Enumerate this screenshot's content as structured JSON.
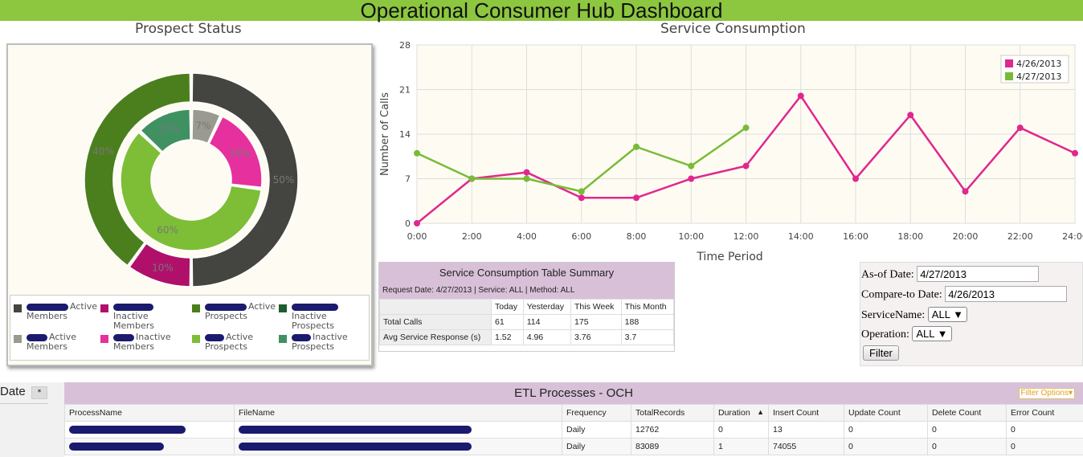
{
  "page_title": "Operational Consumer Hub Dashboard",
  "prospect_status": {
    "title": "Prospect Status",
    "outer_ring": [
      {
        "label": "Active Members",
        "value": 50,
        "pct_label": "50%",
        "color": "#444440"
      },
      {
        "label": "Inactive Members",
        "value": 10,
        "pct_label": "10%",
        "color": "#b0106a"
      },
      {
        "label": "Active Prospects",
        "value": 40,
        "pct_label": "40%",
        "color": "#4b7f1d"
      }
    ],
    "inner_ring": [
      {
        "label": "Active Members",
        "value": 7,
        "pct_label": "7%",
        "color": "#9a9a90"
      },
      {
        "label": "Inactive Members",
        "value": 20,
        "pct_label": "20%",
        "color": "#e6309e"
      },
      {
        "label": "Active Prospects",
        "value": 60,
        "pct_label": "60%",
        "color": "#7dbe36"
      },
      {
        "label": "Inactive Prospects",
        "value": 13,
        "pct_label": "13%",
        "color": "#3f9162"
      }
    ],
    "legend": [
      {
        "text": "Active Members",
        "color": "#444440"
      },
      {
        "text": "Inactive Members",
        "color": "#b0106a"
      },
      {
        "text": "Active Prospects",
        "color": "#4b7f1d"
      },
      {
        "text": "Inactive Prospects",
        "color": "#1e5e2e"
      },
      {
        "text": "Active Members",
        "color": "#9a9a90"
      },
      {
        "text": "Inactive Members",
        "color": "#e6309e"
      },
      {
        "text": "Active Prospects",
        "color": "#7dbe36"
      },
      {
        "text": "Inactive Prospects",
        "color": "#3f9162"
      }
    ]
  },
  "chart_data": {
    "type": "line",
    "title": "Service Consumption",
    "xlabel": "Time Period",
    "ylabel": "Number of Calls",
    "ylim": [
      0,
      28
    ],
    "yticks": [
      0,
      7,
      14,
      21,
      28
    ],
    "x_tick_labels": [
      "0:00",
      "2:00",
      "4:00",
      "6:00",
      "8:00",
      "10:00",
      "12:00",
      "14:00",
      "16:00",
      "18:00",
      "20:00",
      "22:00",
      "24:00"
    ],
    "xlim": [
      0,
      24
    ],
    "grid": true,
    "legend_position": "top-right",
    "series": [
      {
        "name": "4/26/2013",
        "color": "#e0288e",
        "x": [
          0,
          2,
          4,
          6,
          8,
          10,
          12,
          14,
          16,
          18,
          20,
          22,
          24
        ],
        "values": [
          0,
          7,
          8,
          4,
          4,
          7,
          9,
          20,
          7,
          17,
          5,
          15,
          11
        ]
      },
      {
        "name": "4/27/2013",
        "color": "#78bb37",
        "x": [
          0,
          2,
          4,
          6,
          8,
          10,
          12
        ],
        "values": [
          11,
          7,
          7,
          5,
          12,
          9,
          15
        ]
      }
    ]
  },
  "summary": {
    "title": "Service Consumption Table Summary",
    "subtitle": "Request Date: 4/27/2013 | Service: ALL | Method: ALL",
    "columns": [
      "",
      "Today",
      "Yesterday",
      "This Week",
      "This Month"
    ],
    "rows": [
      {
        "label": "Total Calls",
        "values": [
          "61",
          "114",
          "175",
          "188"
        ]
      },
      {
        "label": "Avg Service Response (s)",
        "values": [
          "1.52",
          "4.96",
          "3.76",
          "3.7"
        ]
      }
    ]
  },
  "filter": {
    "as_of_label": "As-of Date:",
    "as_of_value": "4/27/2013",
    "compare_label": "Compare-to Date:",
    "compare_value": "4/26/2013",
    "service_label": "ServiceName:",
    "service_value": "ALL",
    "operation_label": "Operation:",
    "operation_value": "ALL",
    "button_label": "Filter"
  },
  "date_panel": {
    "label": "Date",
    "toggle": "*"
  },
  "etl": {
    "title": "ETL Processes - OCH",
    "filter_options": "Filter Options",
    "columns": [
      "ProcessName",
      "FileName",
      "Frequency",
      "TotalRecords",
      "Duration",
      "Insert Count",
      "Update Count",
      "Delete Count",
      "Error Count"
    ],
    "sort_indicator": "▲",
    "rows": [
      {
        "frequency": "Daily",
        "total": "12762",
        "duration": "0",
        "insert": "13",
        "update": "0",
        "delete": "0",
        "error": "0"
      },
      {
        "frequency": "Daily",
        "total": "83089",
        "duration": "1",
        "insert": "74055",
        "update": "0",
        "delete": "0",
        "error": "0"
      }
    ]
  }
}
